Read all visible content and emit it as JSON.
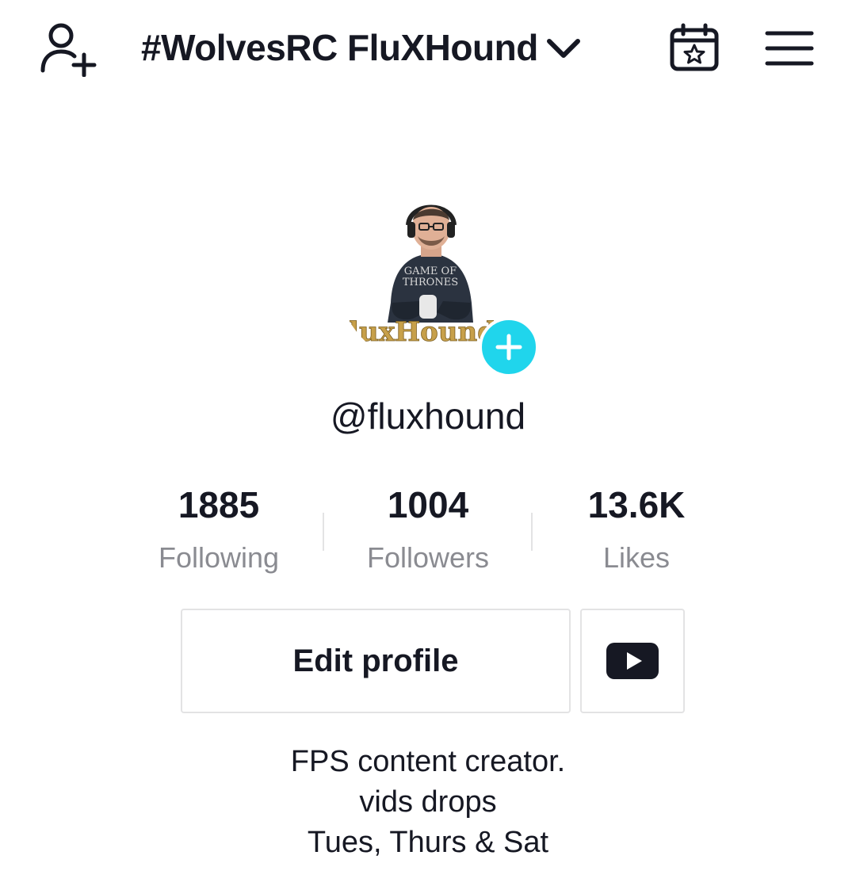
{
  "header": {
    "title": "#WolvesRC FluXHound",
    "add_user_icon": "person-add-icon",
    "dropdown_icon": "chevron-down-icon",
    "calendar_icon": "calendar-star-icon",
    "menu_icon": "hamburger-menu-icon"
  },
  "profile": {
    "avatar_logo_text": "FluxHound",
    "avatar_shirt_text": "GAME OF THRONES",
    "avatar_add_icon": "plus-icon",
    "username": "@fluxhound"
  },
  "stats": [
    {
      "value": "1885",
      "label": "Following"
    },
    {
      "value": "1004",
      "label": "Followers"
    },
    {
      "value": "13.6K",
      "label": "Likes"
    }
  ],
  "actions": {
    "edit_profile_label": "Edit profile",
    "youtube_icon": "youtube-icon"
  },
  "bio": {
    "lines": [
      "FPS content creator.",
      "vids drops",
      "Tues, Thurs & Sat"
    ]
  },
  "colors": {
    "text": "#161823",
    "muted": "#8a8b91",
    "accent": "#20d5ec",
    "border": "#e3e3e4"
  }
}
